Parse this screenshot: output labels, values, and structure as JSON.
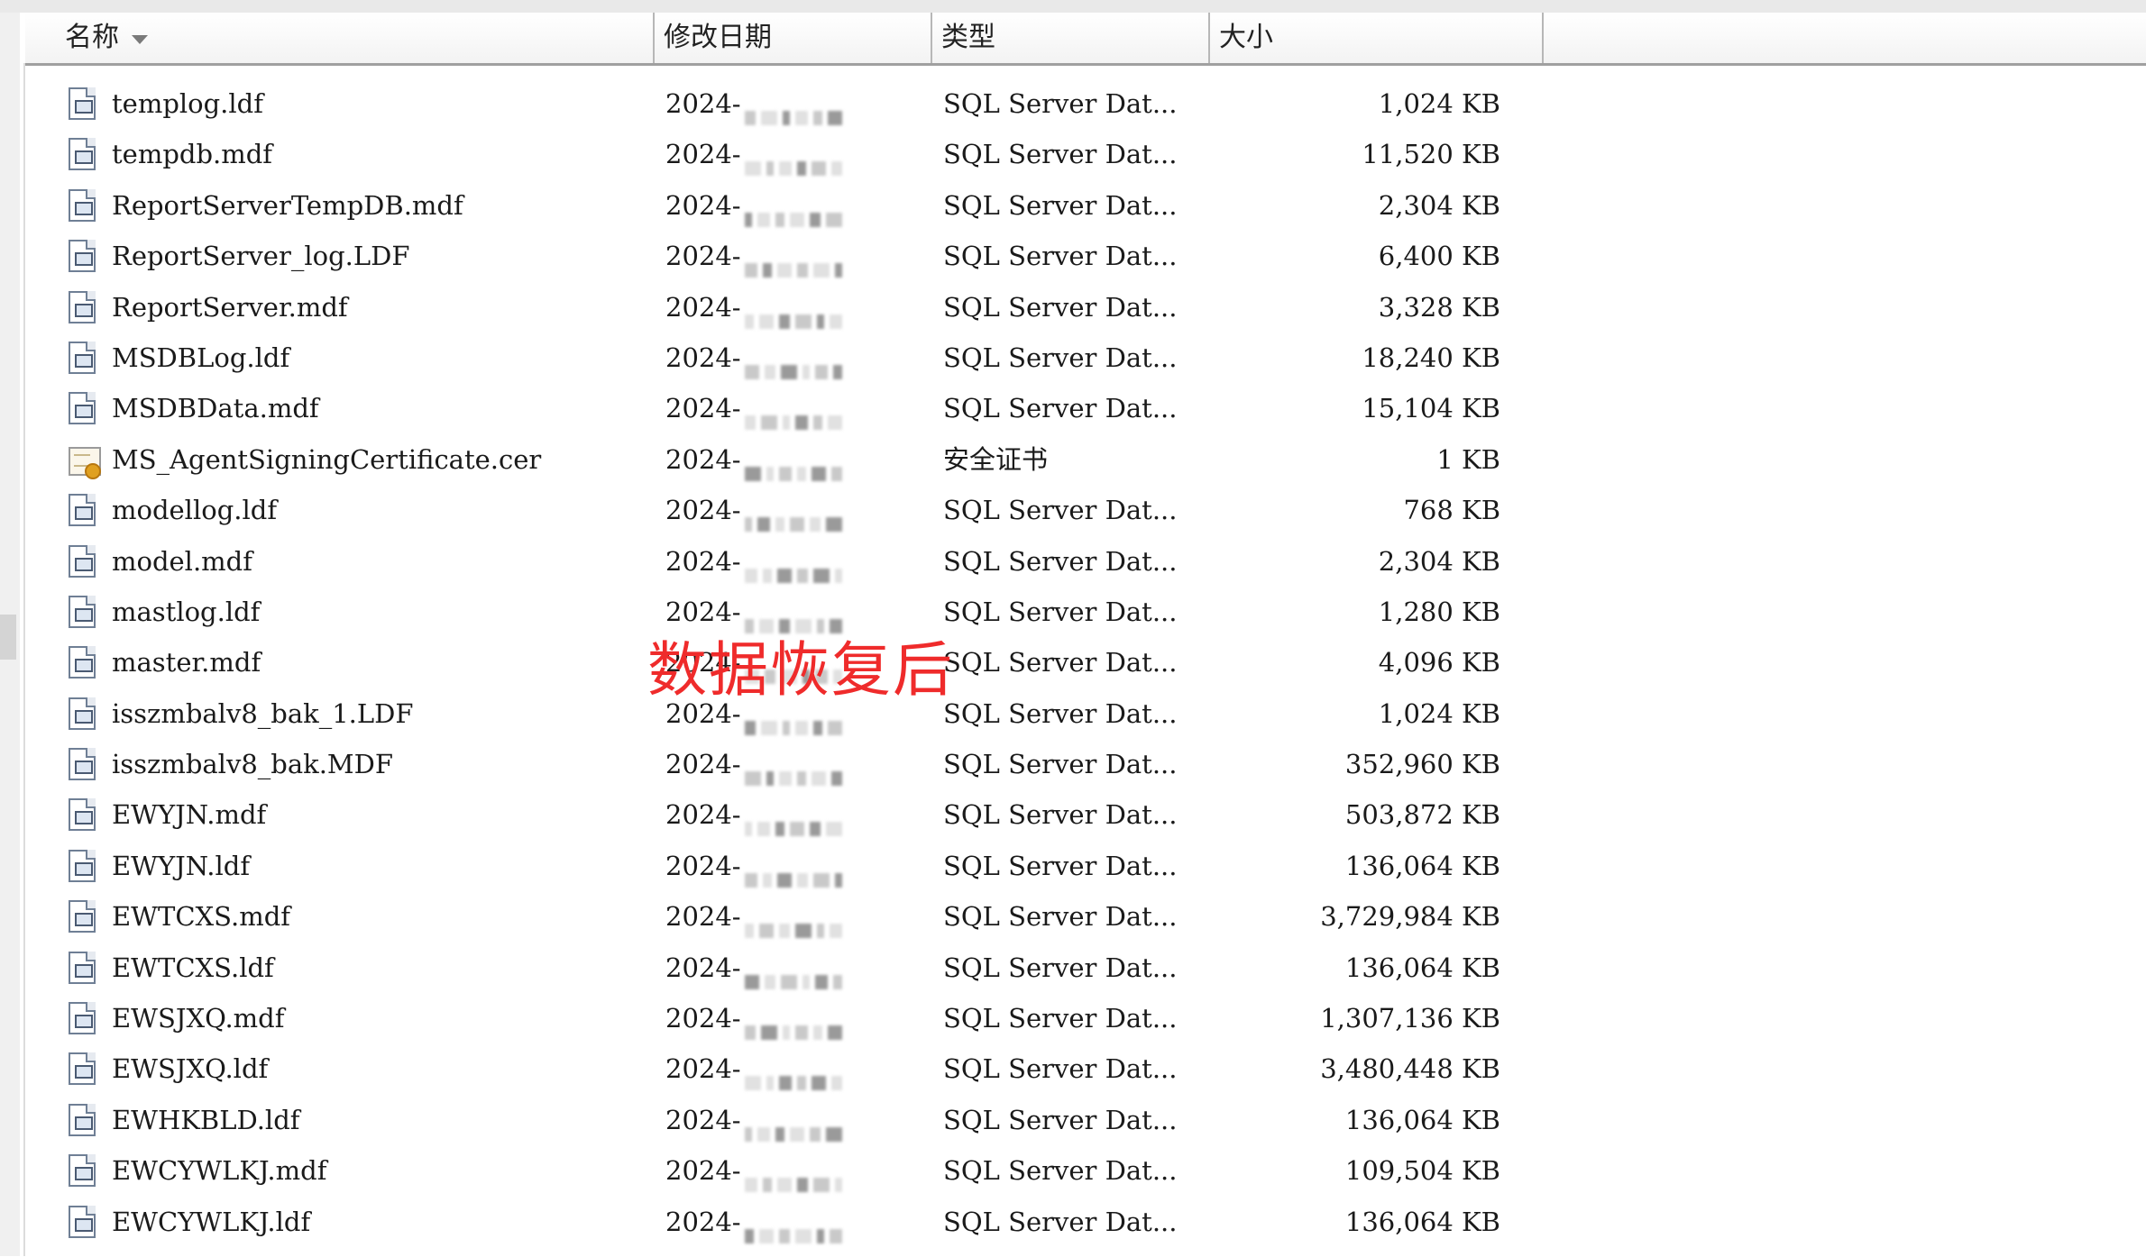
{
  "header": {
    "col_name": "名称",
    "col_date": "修改日期",
    "col_type": "类型",
    "col_size": "大小"
  },
  "overlay_label": "数据恢复后",
  "files": [
    {
      "name": "templog.ldf",
      "date": "2024-",
      "type": "SQL Server Dat...",
      "size": "1,024 KB",
      "icon": "sql-data-file-icon"
    },
    {
      "name": "tempdb.mdf",
      "date": "2024-",
      "type": "SQL Server Dat...",
      "size": "11,520 KB",
      "icon": "sql-data-file-icon"
    },
    {
      "name": "ReportServerTempDB.mdf",
      "date": "2024-",
      "type": "SQL Server Dat...",
      "size": "2,304 KB",
      "icon": "sql-data-file-icon"
    },
    {
      "name": "ReportServer_log.LDF",
      "date": "2024-",
      "type": "SQL Server Dat...",
      "size": "6,400 KB",
      "icon": "sql-data-file-icon"
    },
    {
      "name": "ReportServer.mdf",
      "date": "2024-",
      "type": "SQL Server Dat...",
      "size": "3,328 KB",
      "icon": "sql-data-file-icon"
    },
    {
      "name": "MSDBLog.ldf",
      "date": "2024-",
      "type": "SQL Server Dat...",
      "size": "18,240 KB",
      "icon": "sql-data-file-icon"
    },
    {
      "name": "MSDBData.mdf",
      "date": "2024-",
      "type": "SQL Server Dat...",
      "size": "15,104 KB",
      "icon": "sql-data-file-icon"
    },
    {
      "name": "MS_AgentSigningCertificate.cer",
      "date": "2024-",
      "type": "安全证书",
      "size": "1 KB",
      "icon": "certificate-icon"
    },
    {
      "name": "modellog.ldf",
      "date": "2024-",
      "type": "SQL Server Dat...",
      "size": "768 KB",
      "icon": "sql-data-file-icon"
    },
    {
      "name": "model.mdf",
      "date": "2024-",
      "type": "SQL Server Dat...",
      "size": "2,304 KB",
      "icon": "sql-data-file-icon"
    },
    {
      "name": "mastlog.ldf",
      "date": "2024-",
      "type": "SQL Server Dat...",
      "size": "1,280 KB",
      "icon": "sql-data-file-icon"
    },
    {
      "name": "master.mdf",
      "date": "2024-",
      "type": "SQL Server Dat...",
      "size": "4,096 KB",
      "icon": "sql-data-file-icon"
    },
    {
      "name": "isszmbalv8_bak_1.LDF",
      "date": "2024-",
      "type": "SQL Server Dat...",
      "size": "1,024 KB",
      "icon": "sql-data-file-icon"
    },
    {
      "name": "isszmbalv8_bak.MDF",
      "date": "2024-",
      "type": "SQL Server Dat...",
      "size": "352,960 KB",
      "icon": "sql-data-file-icon"
    },
    {
      "name": "EWYJN.mdf",
      "date": "2024-",
      "type": "SQL Server Dat...",
      "size": "503,872 KB",
      "icon": "sql-data-file-icon"
    },
    {
      "name": "EWYJN.ldf",
      "date": "2024-",
      "type": "SQL Server Dat...",
      "size": "136,064 KB",
      "icon": "sql-data-file-icon"
    },
    {
      "name": "EWTCXS.mdf",
      "date": "2024-",
      "type": "SQL Server Dat...",
      "size": "3,729,984 KB",
      "icon": "sql-data-file-icon"
    },
    {
      "name": "EWTCXS.ldf",
      "date": "2024-",
      "type": "SQL Server Dat...",
      "size": "136,064 KB",
      "icon": "sql-data-file-icon"
    },
    {
      "name": "EWSJXQ.mdf",
      "date": "2024-",
      "type": "SQL Server Dat...",
      "size": "1,307,136 KB",
      "icon": "sql-data-file-icon"
    },
    {
      "name": "EWSJXQ.ldf",
      "date": "2024-",
      "type": "SQL Server Dat...",
      "size": "3,480,448 KB",
      "icon": "sql-data-file-icon"
    },
    {
      "name": "EWHKBLD.ldf",
      "date": "2024-",
      "type": "SQL Server Dat...",
      "size": "136,064 KB",
      "icon": "sql-data-file-icon"
    },
    {
      "name": "EWCYWLKJ.mdf",
      "date": "2024-",
      "type": "SQL Server Dat...",
      "size": "109,504 KB",
      "icon": "sql-data-file-icon"
    },
    {
      "name": "EWCYWLKJ.ldf",
      "date": "2024-",
      "type": "SQL Server Dat...",
      "size": "136,064 KB",
      "icon": "sql-data-file-icon"
    }
  ]
}
